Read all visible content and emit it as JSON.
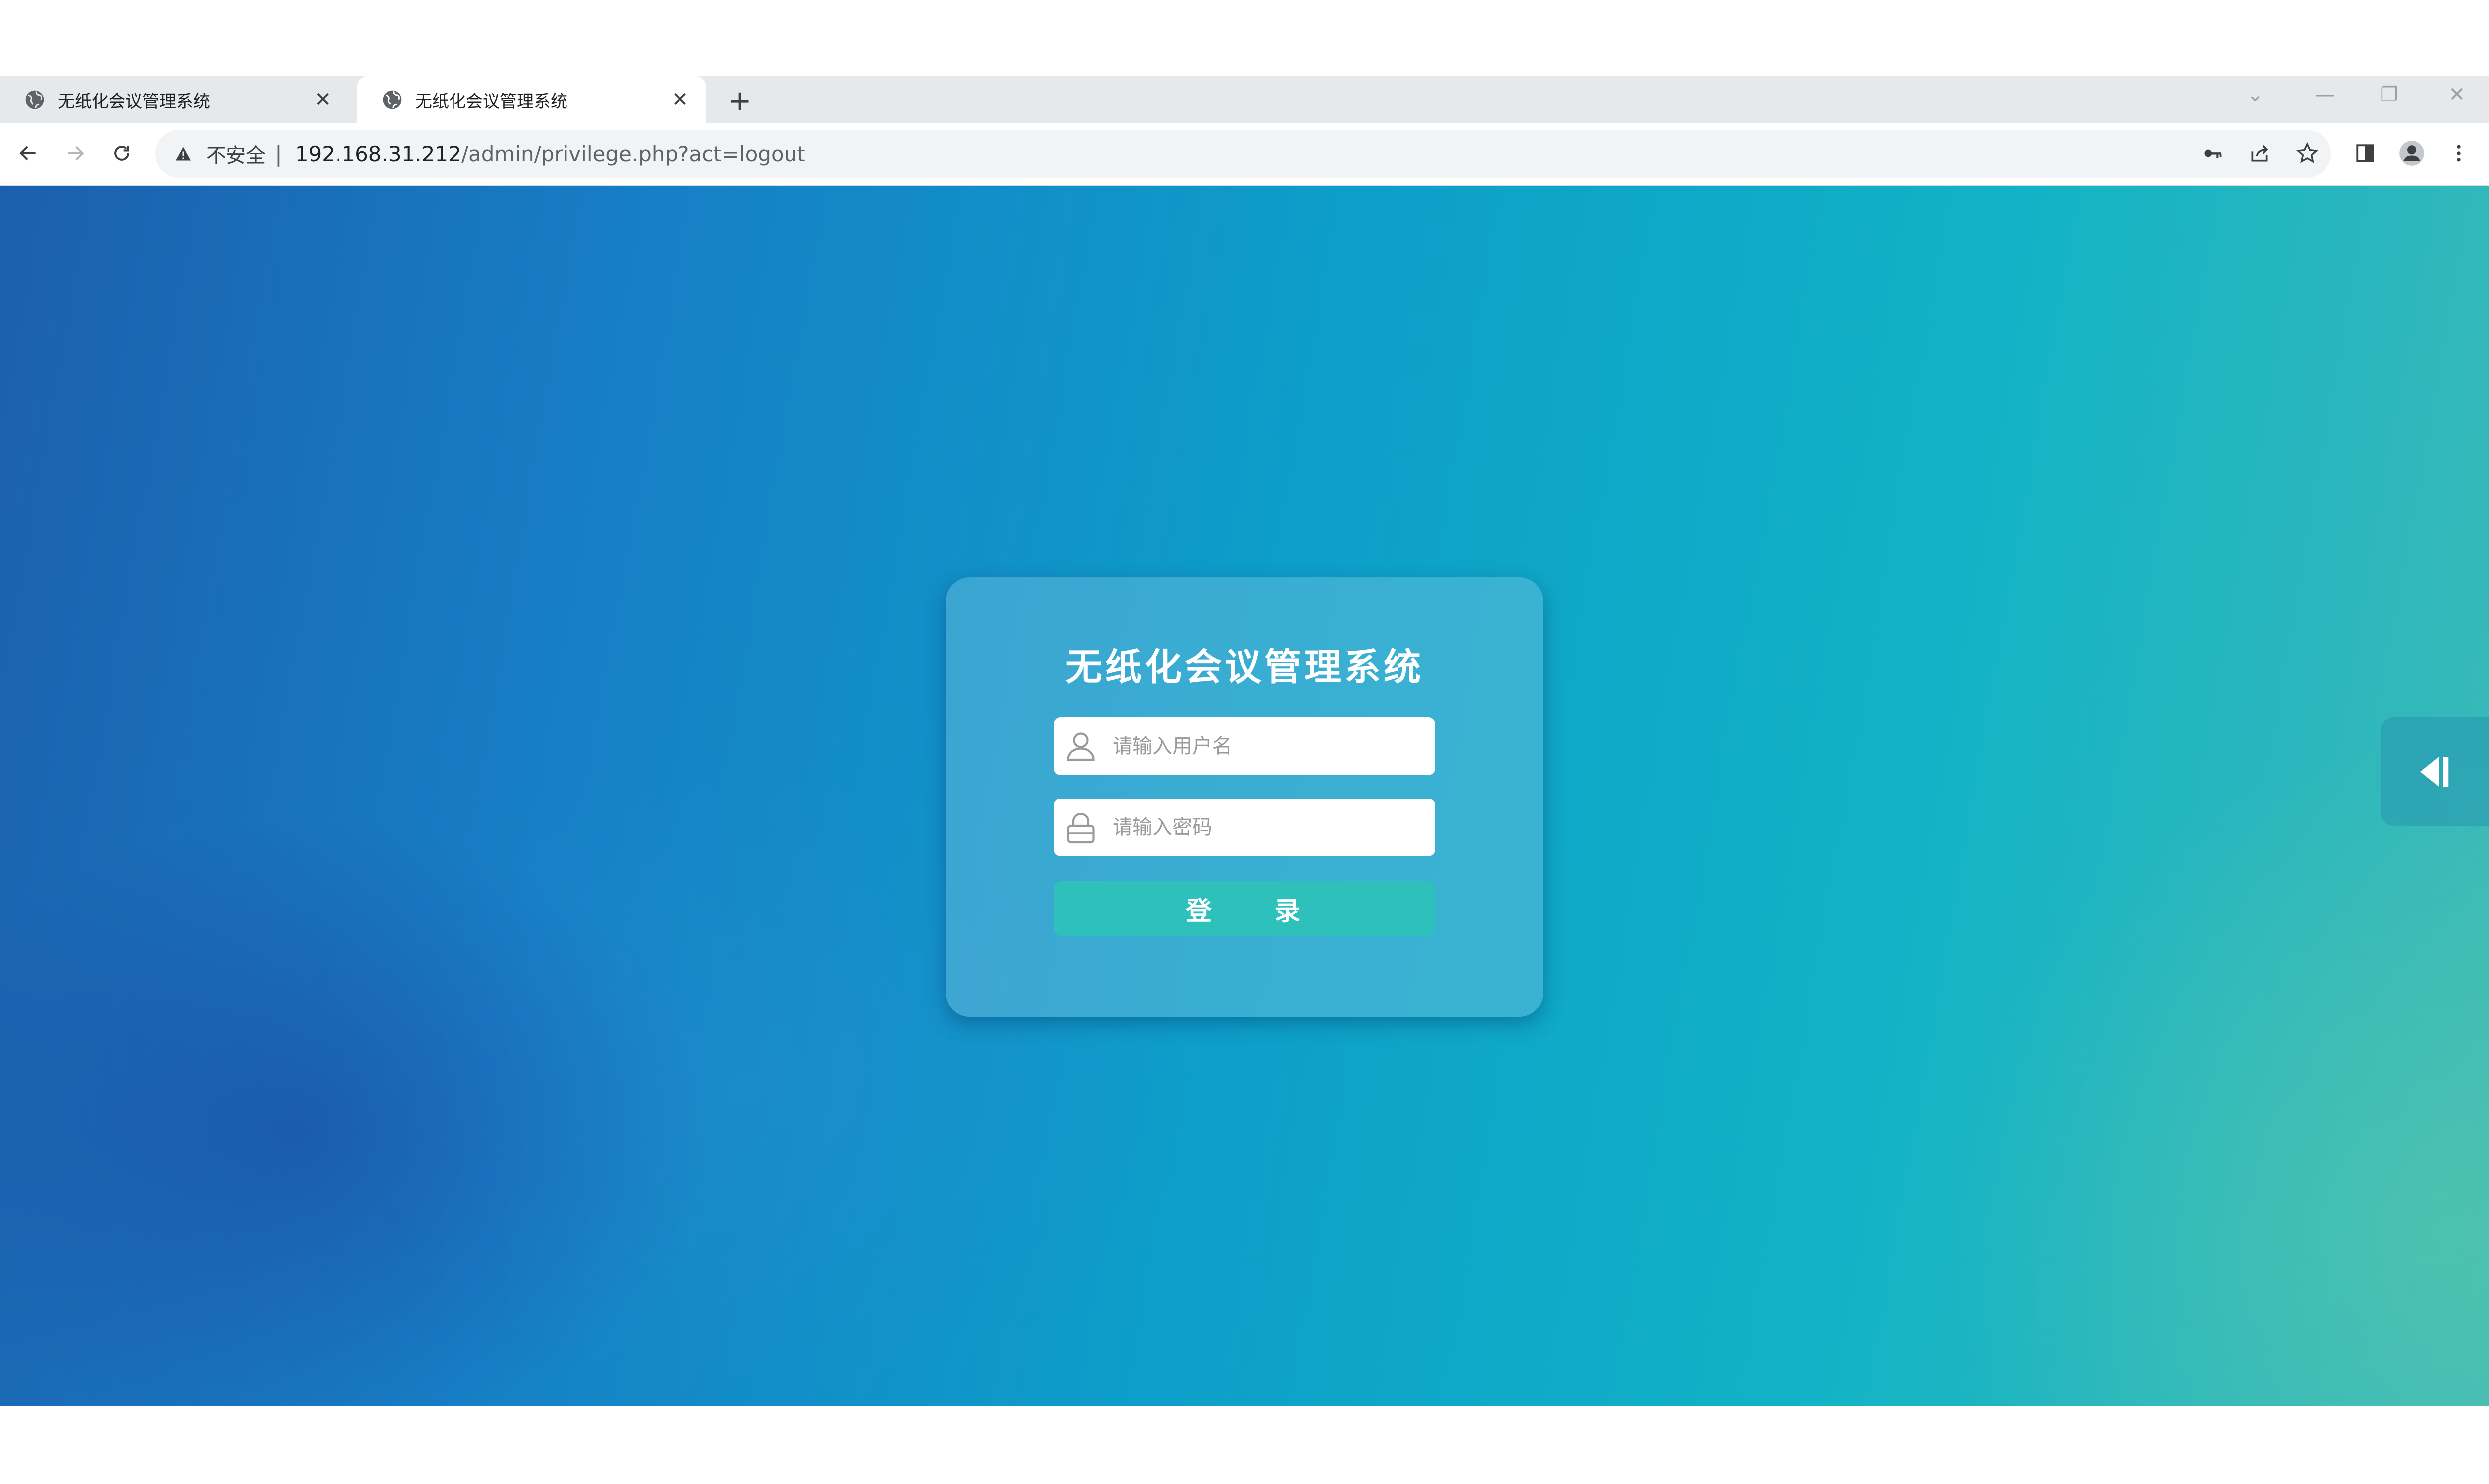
{
  "browser": {
    "tabs": [
      {
        "title": "无纸化会议管理系统",
        "active": false,
        "icon": "globe-icon"
      },
      {
        "title": "无纸化会议管理系统",
        "active": true,
        "icon": "globe-icon"
      }
    ],
    "tab_close_glyph": "✕",
    "new_tab_glyph": "+",
    "window_controls": {
      "minimize": "—",
      "restore": "❐",
      "close": "✕",
      "tab_search": "⌄"
    },
    "address": {
      "security_label": "不安全",
      "separator": "|",
      "host": "192.168.31.212",
      "path": "/admin/privilege.php?act=logout"
    },
    "toolbar_icons": [
      "back-icon",
      "forward-icon",
      "reload-icon",
      "key-icon",
      "share-icon",
      "star-icon",
      "side-panel-icon",
      "profile-icon",
      "menu-icon"
    ]
  },
  "login": {
    "title": "无纸化会议管理系统",
    "username_placeholder": "请输入用户名",
    "password_placeholder": "请输入密码",
    "submit_label": "登     录"
  },
  "colors": {
    "accent_button": "#2ec1bb",
    "background_start": "#1c5fae",
    "background_end": "#3fbab6"
  }
}
